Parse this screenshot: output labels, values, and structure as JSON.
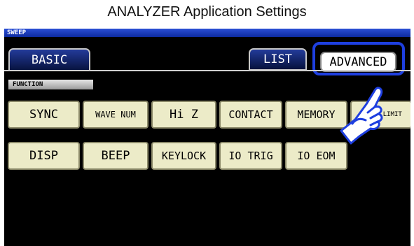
{
  "title": "ANALYZER Application Settings",
  "mode": "SWEEP",
  "tabs": {
    "basic": "BASIC",
    "list": "LIST",
    "advanced": "ADVANCED"
  },
  "section_label": "FUNCTION",
  "buttons": {
    "sync": "SYNC",
    "wave_num": "WAVE NUM",
    "hi_z": "Hi Z",
    "contact": "CONTACT",
    "memory": "MEMORY",
    "range_limit": "RANGE LIMIT",
    "disp": "DISP",
    "beep": "BEEP",
    "keylock": "KEYLOCK",
    "io_trig": "IO TRIG",
    "io_eom": "IO EOM"
  },
  "icons": {
    "pointer": "pointing-hand-icon"
  },
  "colors": {
    "screen_background": "#000000",
    "mode_bar": "#1b3cc8",
    "button_fill": "#ecebc8",
    "highlight": "#1e3fe0"
  }
}
